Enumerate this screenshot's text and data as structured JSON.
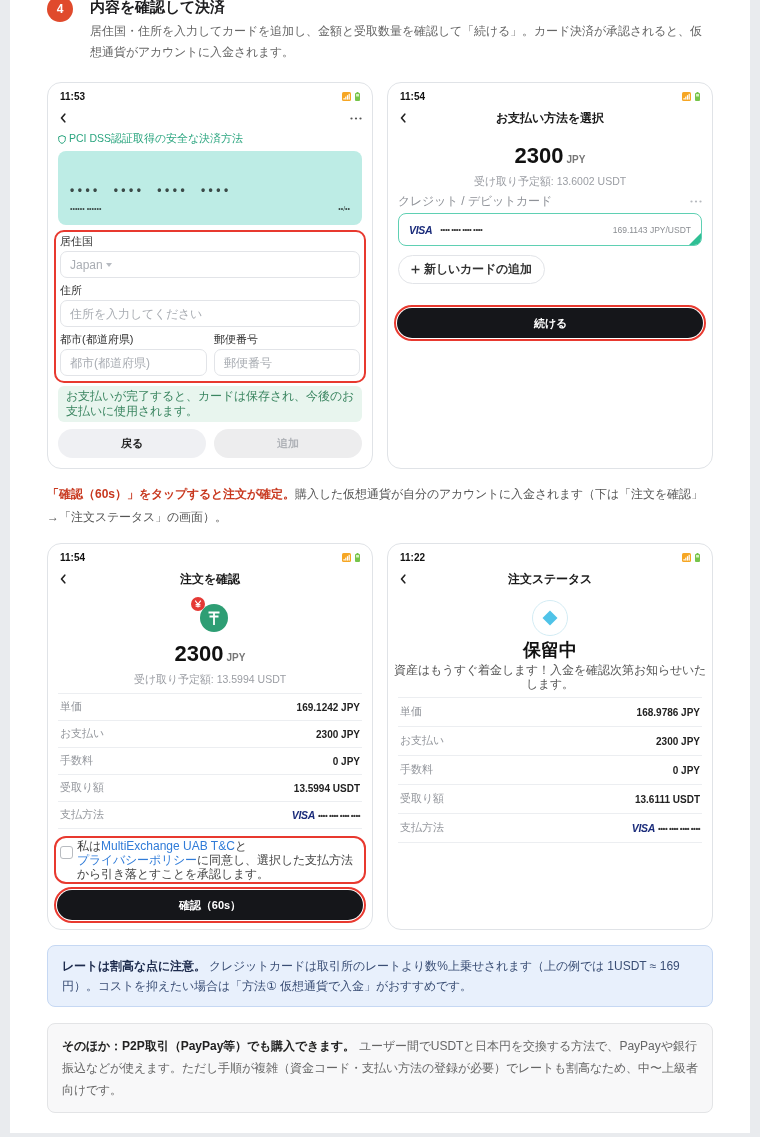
{
  "step": {
    "number": "4",
    "title": "内容を確認して決済",
    "description": "居住国・住所を入力してカードを追加し、金額と受取数量を確認して「続ける」。カード決済が承認されると、仮想通貨がアカウントに入金されます。"
  },
  "screens_top": [
    {
      "kind": "card_form",
      "time": "11:53",
      "security_note": "PCI DSS認証取得の安全な決済方法",
      "card": {
        "number": "•••• •••• •••• ••••",
        "holder": "•••••• ••••••",
        "expiry": "••/••"
      },
      "address": {
        "highlighted": true,
        "rows": [
          [
            {
              "kind": "select",
              "label": "居住国",
              "placeholder": "Japan"
            }
          ],
          [
            {
              "kind": "text",
              "label": "住所",
              "placeholder": "住所を入力してください"
            }
          ],
          [
            {
              "kind": "text",
              "label": "都市(都道府県)",
              "placeholder": "都市(都道府県)"
            },
            {
              "kind": "text",
              "label": "郵便番号",
              "placeholder": "郵便番号"
            }
          ]
        ]
      },
      "notice": "お支払いが完了すると、カードは保存され、今後のお支払いに使用されます。",
      "buttons": [
        {
          "label": "戻る",
          "disabled": false
        },
        {
          "label": "追加",
          "disabled": true
        }
      ]
    },
    {
      "kind": "payment_method",
      "time": "11:54",
      "title": "お支払い方法を選択",
      "amount": {
        "value": "2300",
        "currency": "JPY",
        "receive": "受け取り予定額: 13.6002 USDT"
      },
      "section_label": "クレジット / デビットカード",
      "cards": [
        {
          "brand": "VISA",
          "number": "•••• •••• •••• ••••",
          "rate": "169.1143 JPY/USDT",
          "selected": true
        }
      ],
      "add_card": "新しいカードの追加",
      "continue_button": {
        "label": "続ける",
        "highlighted": true
      }
    }
  ],
  "caption": "**「確認（60s）」をタップすると注文が確定。**購入した仮想通貨が自分のアカウントに入金されます（下は「注文を確認」→「注文ステータス」の画面）。",
  "screens_bottom": [
    {
      "kind": "order_confirm",
      "time": "11:54",
      "title": "注文を確認",
      "amount": {
        "value": "2300",
        "currency": "JPY",
        "receive": "受け取り予定額: 13.5994 USDT"
      },
      "details": [
        {
          "kind": "text",
          "label": "単価",
          "value": "169.1242 JPY"
        },
        {
          "kind": "text",
          "label": "お支払い",
          "value": "2300 JPY"
        },
        {
          "kind": "text",
          "label": "手数料",
          "value": "0 JPY"
        },
        {
          "kind": "text",
          "label": "受取り額",
          "value": "13.5994 USDT"
        },
        {
          "kind": "card",
          "label": "支払方法",
          "brand": "VISA",
          "value": "•••• •••• •••• ••••"
        }
      ],
      "agreement": {
        "checked": false,
        "highlighted": true,
        "parts": [
          {
            "kind": "text",
            "text": "私は"
          },
          {
            "kind": "link",
            "text": "MultiExchange UAB T&C"
          },
          {
            "kind": "text",
            "text": "と"
          },
          {
            "kind": "link",
            "text": "プライバシーポリシー"
          },
          {
            "kind": "text",
            "text": "に同意し、選択した支払方法から引き落とすことを承認します。"
          }
        ]
      },
      "confirm_button": {
        "label": "確認（60s）",
        "highlighted": true
      }
    },
    {
      "kind": "order_status",
      "time": "11:22",
      "title": "注文ステータス",
      "status": "保留中",
      "message": "資産はもうすぐ着金します！入金を確認次第お知らせいたします。",
      "details": [
        {
          "kind": "text",
          "label": "単価",
          "value": "168.9786 JPY"
        },
        {
          "kind": "text",
          "label": "お支払い",
          "value": "2300 JPY"
        },
        {
          "kind": "text",
          "label": "手数料",
          "value": "0 JPY"
        },
        {
          "kind": "text",
          "label": "受取り額",
          "value": "13.6111 USDT"
        },
        {
          "kind": "card",
          "label": "支払方法",
          "brand": "VISA",
          "value": "•••• •••• •••• ••••"
        }
      ]
    }
  ],
  "notes": [
    {
      "kind": "info",
      "text": "**レートは割高な点に注意。** クレジットカードは取引所のレートより数%上乗せされます（上の例では 1USDT ≈ 169円）。コストを抑えたい場合は「方法① 仮想通貨で入金」がおすすめです。"
    },
    {
      "kind": "neutral",
      "text": "**そのほか：P2P取引（PayPay等）でも購入できます。** ユーザー間でUSDTと日本円を交換する方法で、PayPayや銀行振込などが使えます。ただし手順が複雑（資金コード・支払い方法の登録が必要）でレートも割高なため、中〜上級者向けです。"
    }
  ]
}
